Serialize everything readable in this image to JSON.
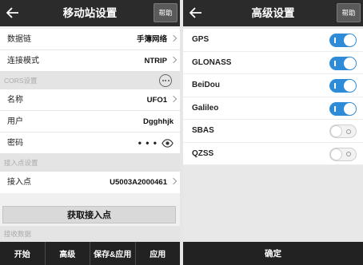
{
  "left": {
    "title": "移动站设置",
    "help": "帮助",
    "rows": [
      {
        "label": "数据链",
        "value": "手簿网络"
      },
      {
        "label": "连接模式",
        "value": "NTRIP"
      }
    ],
    "cors_section": "CORS设置",
    "cors_rows": [
      {
        "label": "名称",
        "value": "UFO1"
      },
      {
        "label": "用户",
        "value": "Dgghhjk"
      },
      {
        "label": "密码",
        "value": "• • •"
      }
    ],
    "mount_section": "接入点设置",
    "mount_row": {
      "label": "接入点",
      "value": "U5003A2000461"
    },
    "get_mount_button": "获取接入点",
    "recv_section": "接收数据",
    "bottom": [
      "开始",
      "高级",
      "保存&应用",
      "应用"
    ]
  },
  "right": {
    "title": "高级设置",
    "help": "帮助",
    "systems": [
      {
        "label": "GPS",
        "on": true
      },
      {
        "label": "GLONASS",
        "on": true
      },
      {
        "label": "BeiDou",
        "on": true
      },
      {
        "label": "Galileo",
        "on": true
      },
      {
        "label": "SBAS",
        "on": false
      },
      {
        "label": "QZSS",
        "on": false
      }
    ],
    "confirm": "确定"
  },
  "colors": {
    "toggle_on": "#2e8bd8",
    "topbar": "#2b2b2b",
    "bottombar": "#222222"
  }
}
